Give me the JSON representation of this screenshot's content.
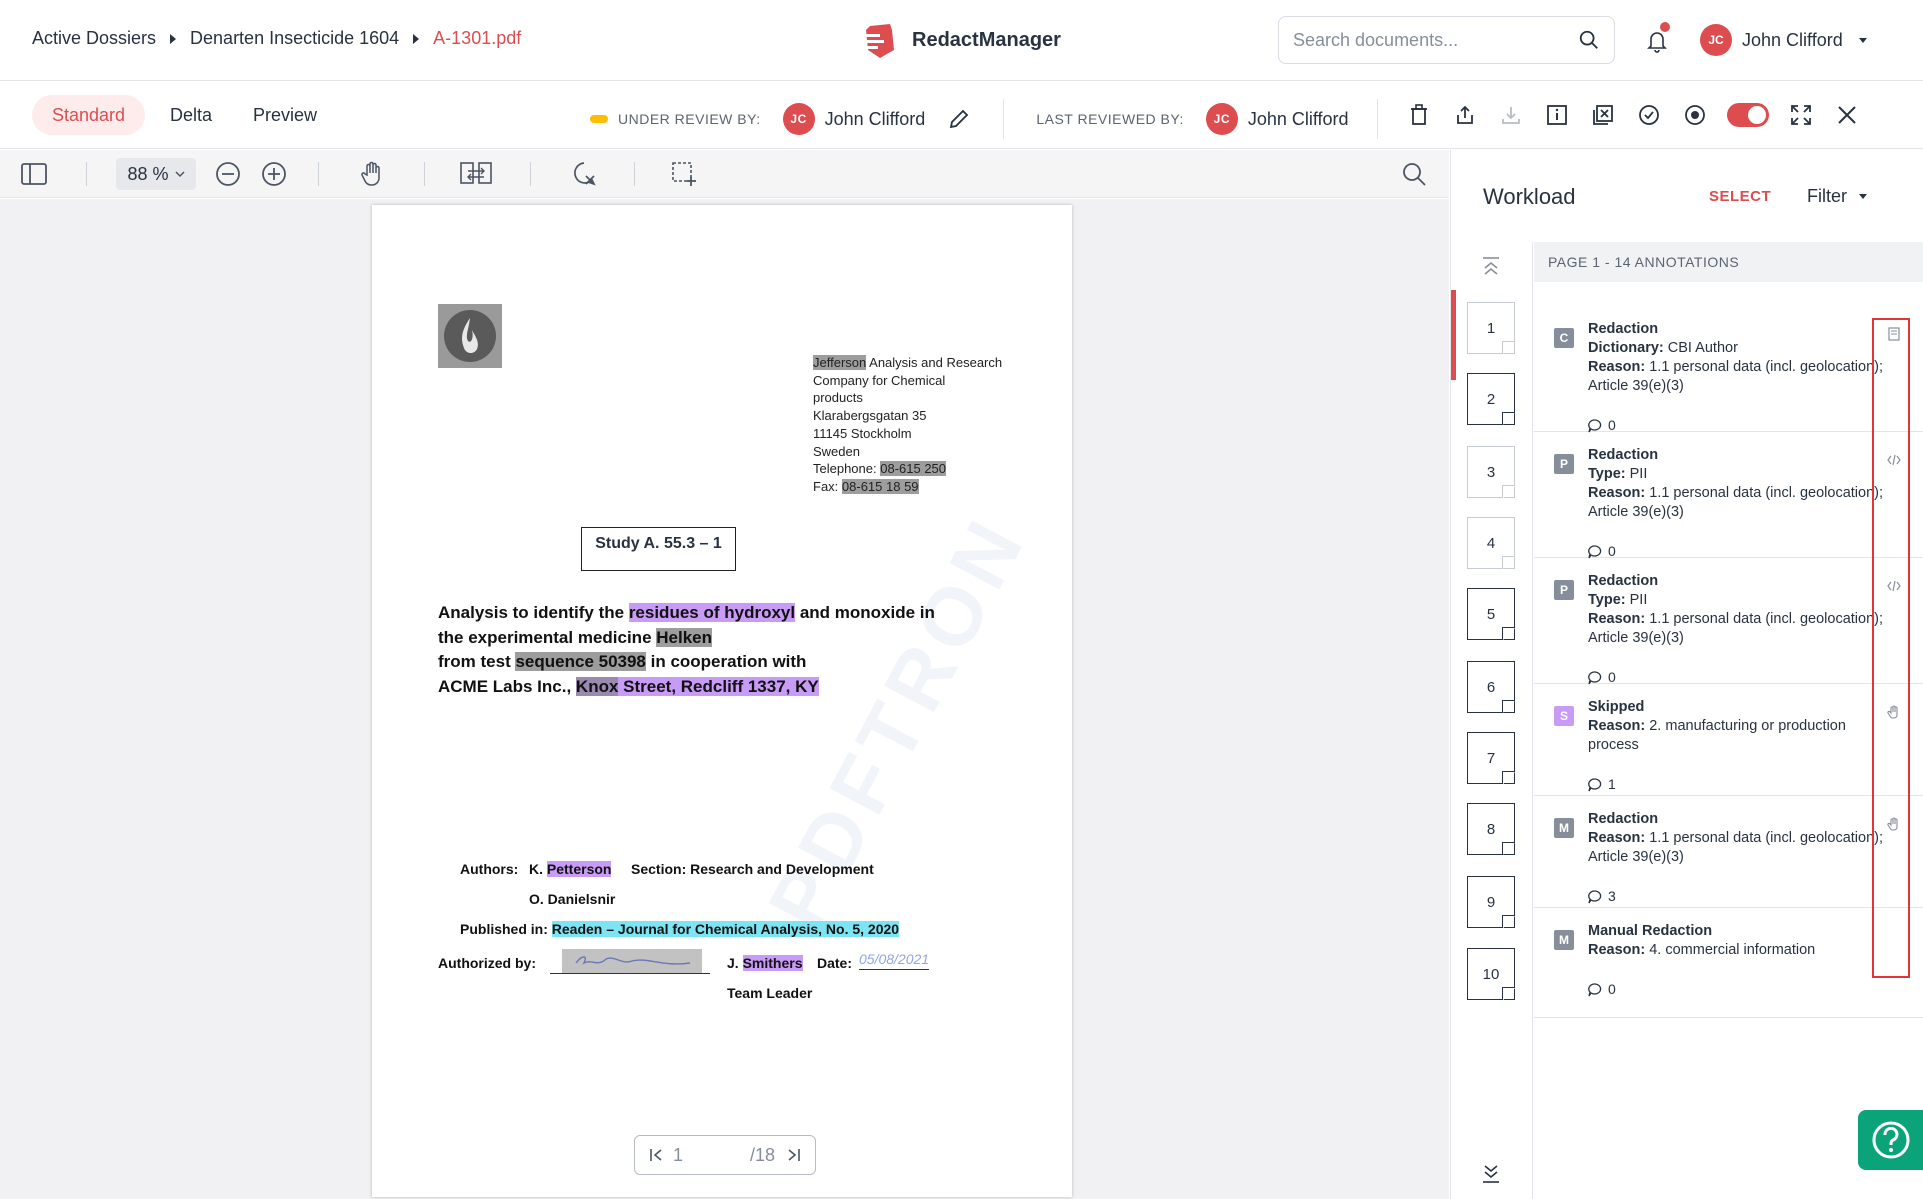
{
  "breadcrumb": {
    "dossiers": "Active Dossiers",
    "dossier": "Denarten Insecticide 1604",
    "file": "A-1301.pdf"
  },
  "app": {
    "name": "RedactManager",
    "brand_color": "#dd4d50"
  },
  "search": {
    "placeholder": "Search documents..."
  },
  "user": {
    "initials": "JC",
    "name": "John Clifford"
  },
  "view_tabs": [
    {
      "label": "Standard"
    },
    {
      "label": "Delta"
    },
    {
      "label": "Preview"
    }
  ],
  "review": {
    "under_label": "UNDER REVIEW BY:",
    "under_name": "John Clifford",
    "last_label": "LAST REVIEWED BY:",
    "last_name": "John Clifford",
    "status_color": "#fdbd00"
  },
  "viewer": {
    "zoom": "88 %"
  },
  "document": {
    "company": "Jefferson",
    "address_line1_rest": " Analysis and Research",
    "address_line2": "Company for Chemical",
    "address_line3": "products",
    "address_line4": "Klarabergsgatan 35",
    "address_line5": "11145 Stockholm",
    "address_line6": "Sweden",
    "telephone_label": "Telephone: ",
    "telephone": "08-615 250",
    "fax_label": "Fax: ",
    "fax": "08-615 18 59",
    "study": "Study A. 55.3 – 1",
    "title_a": "Analysis to identify the ",
    "title_hl1": "residues of hydroxyl",
    "title_b": " and monoxide in",
    "title_c": "the experimental medicine ",
    "title_hl2": "Helken",
    "title_d": "from test ",
    "title_hl3": "sequence 50398",
    "title_e": " in cooperation with",
    "title_f": "ACME Labs Inc., ",
    "title_hl4": "Knox",
    "title_hl5": " Street, Redcliff 1337, KY",
    "authors_label": "Authors:",
    "author1_initial": "K. ",
    "author1_name": "Petterson",
    "section": "Section: Research and Development",
    "author2": "O. Danielsnir",
    "published_label": "Published in: ",
    "published": "Readen – Journal for Chemical Analysis, No. 5, 2020",
    "authorized_label": "Authorized by:",
    "signer_initial": "J. ",
    "signer_name": "Smithers",
    "date_label": "Date:",
    "date": "05/08/2021",
    "role": "Team Leader",
    "watermark": "PDFTRON",
    "page_current": "1",
    "page_total": "/18"
  },
  "workload": {
    "title": "Workload",
    "select": "SELECT",
    "filter": "Filter",
    "page_header": "PAGE 1 - 14 ANNOTATIONS",
    "pages": [
      "1",
      "2",
      "3",
      "4",
      "5",
      "6",
      "7",
      "8",
      "9",
      "10"
    ],
    "annotations": [
      {
        "badge": "C",
        "badge_color": "#868e9c",
        "title": "Redaction",
        "l1_label": "Dictionary:",
        "l1_value": " CBI Author",
        "l2_label": "Reason:",
        "l2_value": " 1.1 personal data (incl. geolocation); Article 39(e)(3)",
        "comments": "0",
        "icon": "document-icon"
      },
      {
        "badge": "P",
        "badge_color": "#868e9c",
        "title": "Redaction",
        "l1_label": "Type:",
        "l1_value": " PII",
        "l2_label": "Reason:",
        "l2_value": " 1.1 personal data (incl. geolocation); Article 39(e)(3)",
        "comments": "0",
        "icon": "code-icon"
      },
      {
        "badge": "P",
        "badge_color": "#868e9c",
        "title": "Redaction",
        "l1_label": "Type:",
        "l1_value": " PII",
        "l2_label": "Reason:",
        "l2_value": " 1.1 personal data (incl. geolocation); Article 39(e)(3)",
        "comments": "0",
        "icon": "code-icon"
      },
      {
        "badge": "S",
        "badge_color": "#c89bf7",
        "title": "Skipped",
        "l1_label": "",
        "l1_value": "",
        "l2_label": "Reason:",
        "l2_value": " 2. manufacturing or production process",
        "comments": "1",
        "icon": "hand-icon"
      },
      {
        "badge": "M",
        "badge_color": "#868e9c",
        "title": "Redaction",
        "l1_label": "",
        "l1_value": "",
        "l2_label": "Reason:",
        "l2_value": " 1.1 personal data (incl. geolocation); Article 39(e)(3)",
        "comments": "3",
        "icon": "hand-icon"
      },
      {
        "badge": "M",
        "badge_color": "#868e9c",
        "title": "Manual Redaction",
        "l1_label": "",
        "l1_value": "",
        "l2_label": "Reason:",
        "l2_value": " 4. commercial information",
        "comments": "0",
        "icon": ""
      }
    ]
  }
}
